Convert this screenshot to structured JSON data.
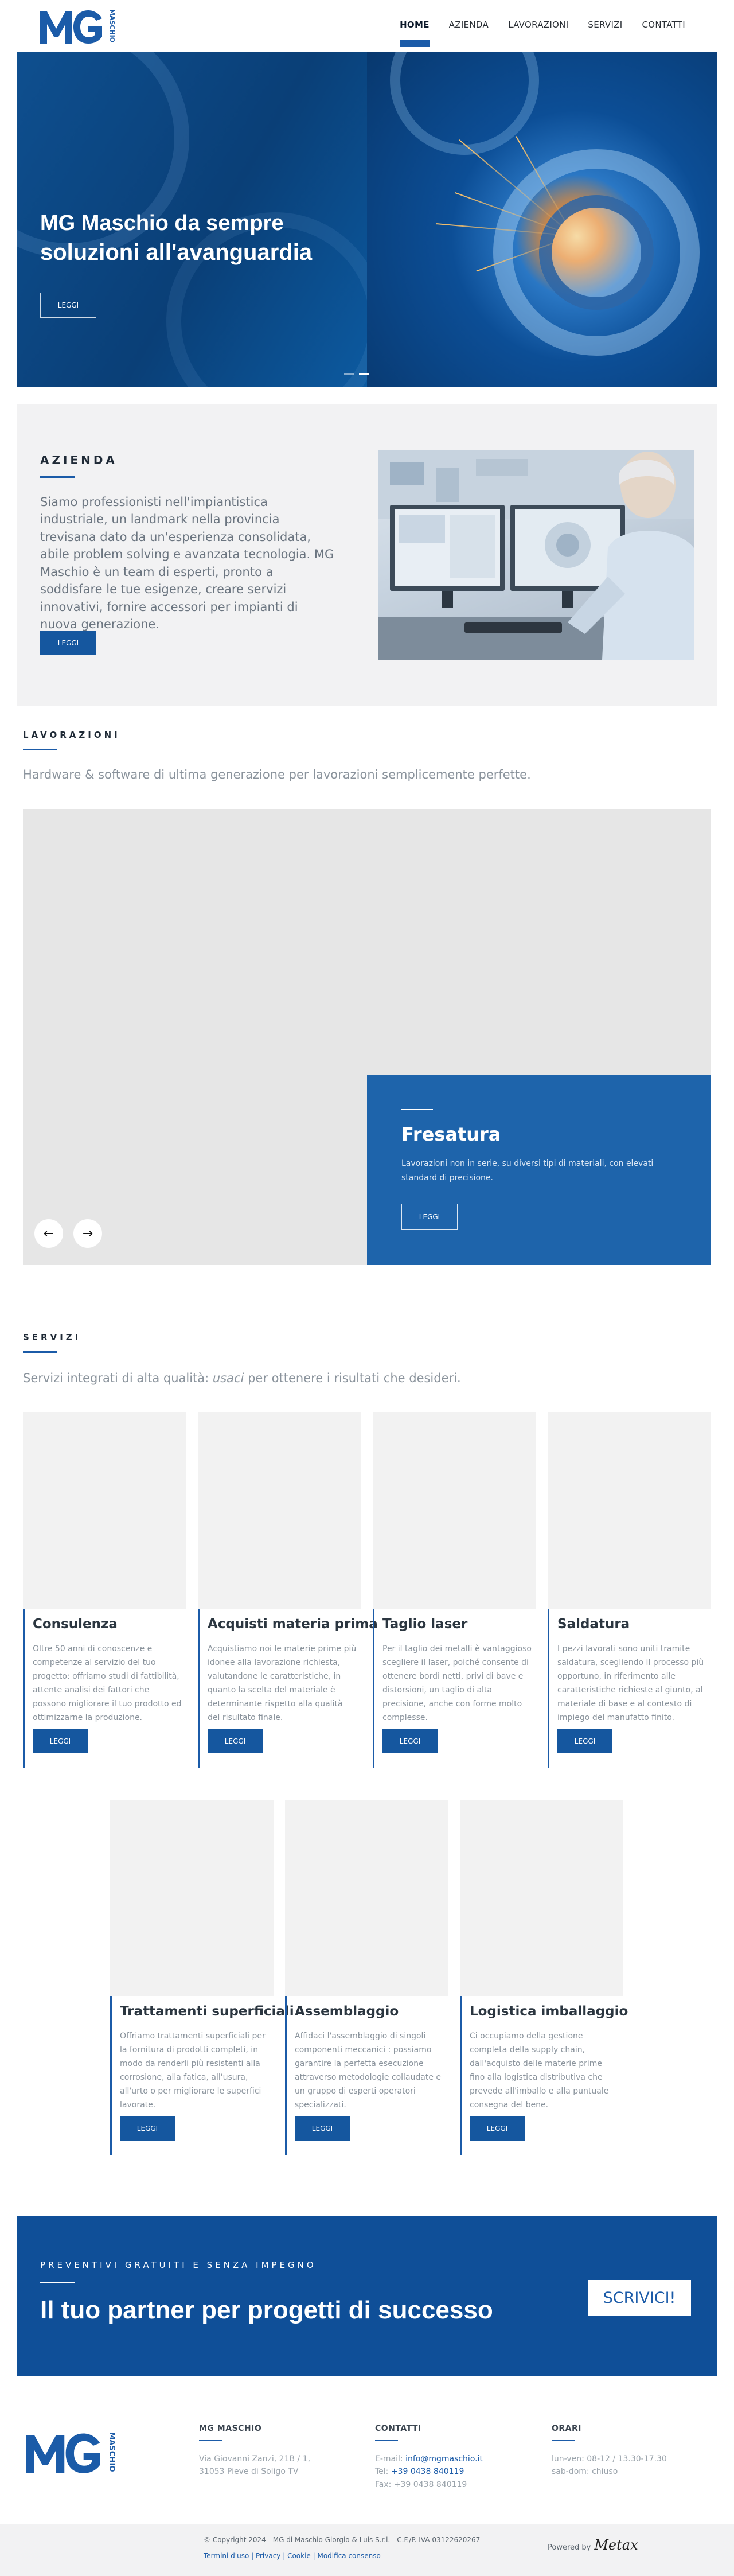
{
  "brand": {
    "logo_letters": "MG",
    "logo_vertical": "MASCHIO",
    "accent": "#1b5ba8"
  },
  "nav": {
    "items": [
      {
        "label": "HOME",
        "active": true
      },
      {
        "label": "AZIENDA"
      },
      {
        "label": "LAVORAZIONI"
      },
      {
        "label": "SERVIZI"
      },
      {
        "label": "CONTATTI"
      }
    ]
  },
  "hero": {
    "title_line1": "MG Maschio da sempre",
    "title_line2": "soluzioni all'avanguardia",
    "button": "LEGGI"
  },
  "azienda": {
    "label": "AZIENDA",
    "text": "Siamo professionisti nell'impiantistica industriale, un landmark nella provincia trevisana dato da un'esperienza consolidata, abile problem solving e avanzata tecnologia. MG Maschio è un team di esperti, pronto a soddisfare le tue esigenze, creare servizi innovativi, fornire accessori per impianti di nuova generazione.",
    "button": "LEGGI"
  },
  "lavorazioni": {
    "label": "LAVORAZIONI",
    "subtitle": "Hardware & software di ultima generazione per lavorazioni semplicemente perfette.",
    "card": {
      "title": "Fresatura",
      "text": "Lavorazioni non in serie, su diversi tipi di materiali, con elevati standard di precisione.",
      "button": "LEGGI"
    },
    "prev_icon": "arrow-left-icon",
    "next_icon": "arrow-right-icon"
  },
  "servizi": {
    "label": "SERVIZI",
    "subtitle_before": "Servizi integrati di alta qualità: ",
    "subtitle_em": "usaci",
    "subtitle_after": " per ottenere i risultati che desideri.",
    "cards": [
      {
        "title": "Consulenza",
        "text": "Oltre 50 anni di conoscenze e competenze al servizio del tuo progetto: offriamo studi di fattibilità, attente analisi dei fattori che possono migliorare il tuo prodotto ed ottimizzarne la produzione.",
        "button": "LEGGI"
      },
      {
        "title": "Acquisti materia prima",
        "text": "Acquistiamo noi le materie prime più idonee alla lavorazione richiesta, valutandone le caratteristiche, in quanto la scelta del materiale è determinante rispetto alla qualità del risultato finale.",
        "button": "LEGGI"
      },
      {
        "title": "Taglio laser",
        "text": "Per il taglio dei metalli è vantaggioso scegliere il laser, poiché consente di ottenere bordi netti, privi di bave e distorsioni, un taglio di alta precisione, anche con forme molto complesse.",
        "button": "LEGGI"
      },
      {
        "title": "Saldatura",
        "text": "I pezzi lavorati sono uniti tramite saldatura, scegliendo il processo più opportuno, in riferimento alle caratteristiche richieste al giunto, al materiale di base e al contesto di impiego del manufatto finito.",
        "button": "LEGGI"
      },
      {
        "title": "Trattamenti superficiali",
        "text": "Offriamo trattamenti superficiali per la fornitura di prodotti completi, in modo da renderli più resistenti alla corrosione, alla fatica, all'usura, all'urto o per migliorare le superfici lavorate.",
        "button": "LEGGI"
      },
      {
        "title": "Assemblaggio",
        "text": "Affidaci l'assemblaggio di singoli componenti meccanici : possiamo garantire la perfetta esecuzione attraverso metodologie collaudate e un gruppo di esperti operatori specializzati.",
        "button": "LEGGI"
      },
      {
        "title": "Logistica imballaggio",
        "text": "Ci occupiamo della gestione completa della supply chain, dall'acquisto delle materie prime fino alla logistica distributiva che prevede all'imballo e alla puntuale consegna del bene.",
        "button": "LEGGI"
      }
    ]
  },
  "cta": {
    "label": "PREVENTIVI GRATUITI E SENZA IMPEGNO",
    "title": "Il tuo partner per progetti di successo",
    "button": "SCRIVICI!"
  },
  "footer": {
    "company": {
      "head": "MG MASCHIO",
      "address1": "Via Giovanni Zanzi, 21B / 1,",
      "address2": "31053 Pieve di Soligo TV"
    },
    "contatti": {
      "head": "CONTATTI",
      "email_label": "E-mail: ",
      "email": "info@mgmaschio.it",
      "tel_label": "Tel: ",
      "tel": "+39 0438 840119",
      "fax": "Fax: +39 0438 840119"
    },
    "orari": {
      "head": "ORARI",
      "line1": "lun-ven: 08-12 / 13.30-17.30",
      "line2": "sab-dom: chiuso"
    },
    "copyright": "© Copyright 2024 - MG di Maschio Giorgio & Luis S.r.l. - C.F./P. IVA 03122620267",
    "legal_links": "Termini d'uso | Privacy | Cookie | Modifica consenso",
    "powered_label": "Powered by",
    "powered_sig": "Metax"
  }
}
